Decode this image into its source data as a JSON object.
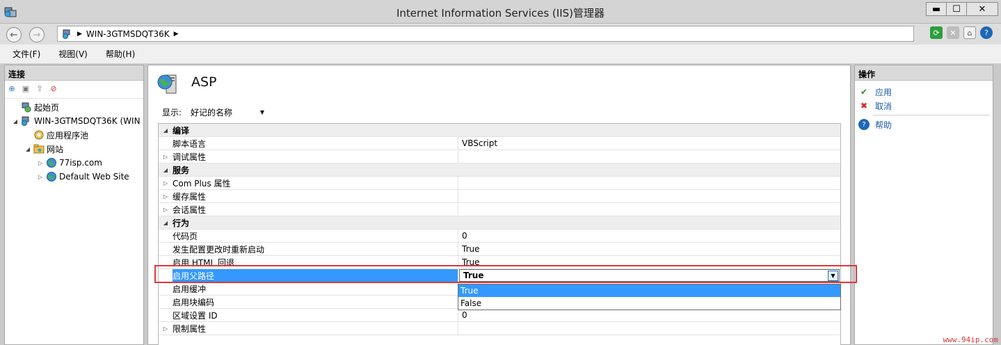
{
  "window": {
    "title": "Internet Information Services (IIS)管理器",
    "min_label": "▬",
    "max_label": "☐",
    "close_label": "✕"
  },
  "address": {
    "server": "WIN-3GTMSDQT36K",
    "sep": "▶"
  },
  "menu": [
    "文件(F)",
    "视图(V)",
    "帮助(H)"
  ],
  "connections": {
    "title": "连接",
    "tree": [
      {
        "label": "起始页",
        "level": 0,
        "expander": ""
      },
      {
        "label": "WIN-3GTMSDQT36K (WIN",
        "level": 0,
        "expander": "◢"
      },
      {
        "label": "应用程序池",
        "level": 1,
        "expander": ""
      },
      {
        "label": "网站",
        "level": 1,
        "expander": "◢"
      },
      {
        "label": "77isp.com",
        "level": 2,
        "expander": "▷"
      },
      {
        "label": "Default Web Site",
        "level": 2,
        "expander": "▷"
      }
    ]
  },
  "feature": {
    "title": "ASP",
    "show_label": "显示:",
    "show_value": "好记的名称",
    "rows": [
      {
        "type": "cat",
        "exp": "◢",
        "name": "编译",
        "value": ""
      },
      {
        "type": "prop",
        "exp": "",
        "name": "脚本语言",
        "value": "VBScript"
      },
      {
        "type": "prop",
        "exp": "▷",
        "name": "调试属性",
        "value": ""
      },
      {
        "type": "cat",
        "exp": "◢",
        "name": "服务",
        "value": ""
      },
      {
        "type": "prop",
        "exp": "▷",
        "name": "Com Plus 属性",
        "value": ""
      },
      {
        "type": "prop",
        "exp": "▷",
        "name": "缓存属性",
        "value": ""
      },
      {
        "type": "prop",
        "exp": "▷",
        "name": "会话属性",
        "value": ""
      },
      {
        "type": "cat",
        "exp": "◢",
        "name": "行为",
        "value": ""
      },
      {
        "type": "prop",
        "exp": "",
        "name": "代码页",
        "value": "0"
      },
      {
        "type": "prop",
        "exp": "",
        "name": "发生配置更改时重新启动",
        "value": "True"
      },
      {
        "type": "prop",
        "exp": "",
        "name": "启用 HTML 回退",
        "value": "True"
      },
      {
        "type": "sel",
        "exp": "",
        "name": "启用父路径",
        "value": "True"
      },
      {
        "type": "prop",
        "exp": "",
        "name": "启用缓冲",
        "value": ""
      },
      {
        "type": "prop",
        "exp": "",
        "name": "启用块编码",
        "value": ""
      },
      {
        "type": "prop",
        "exp": "",
        "name": "区域设置 ID",
        "value": "0"
      },
      {
        "type": "prop",
        "exp": "▷",
        "name": "限制属性",
        "value": ""
      }
    ],
    "dropdown_options": [
      "True",
      "False"
    ]
  },
  "actions": {
    "title": "操作",
    "apply": "应用",
    "cancel": "取消",
    "help": "帮助"
  },
  "watermark": "www.94ip.com",
  "colors": {
    "selection": "#3399ff",
    "highlight_box": "#e0363b",
    "link": "#1c5aa8"
  }
}
